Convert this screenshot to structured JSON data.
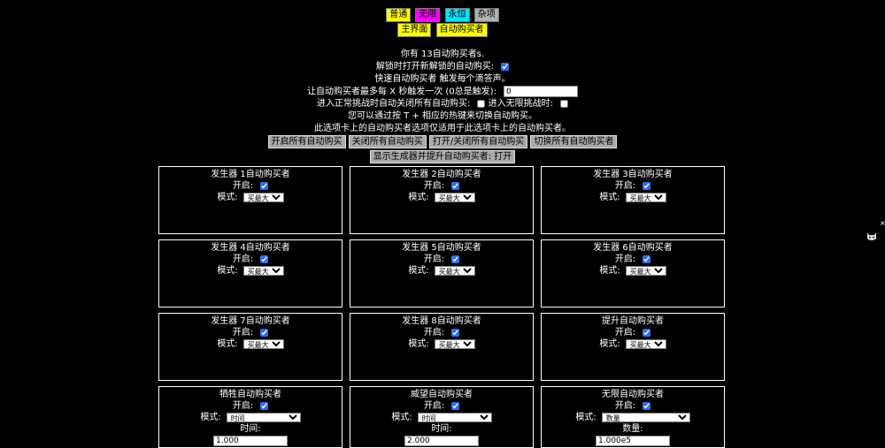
{
  "tabs_top": [
    {
      "label": "普通",
      "color": "#ffff00"
    },
    {
      "label": "无限",
      "color": "#ff00ff"
    },
    {
      "label": "永恒",
      "color": "#00e5ff"
    },
    {
      "label": "杂项",
      "color": "#b0b0b0"
    }
  ],
  "tabs_sub": [
    {
      "label": "主界面",
      "color": "#ffff00"
    },
    {
      "label": "自动购买者",
      "color": "#ffff00"
    }
  ],
  "info": {
    "have": "你有 13自动购买者s.",
    "unlock_label": "解锁时打开新解锁的自动购买:",
    "fast_label": "快速自动购买者 触发每个滴答声。",
    "interval_label": "让自动购买者最多每 X 秒触发一次 (0总是触发):",
    "interval_value": "0",
    "challenge_label": "进入正常挑战时自动关闭所有自动购买:",
    "inf_challenge_label": "进入无限挑战时:",
    "hotkey_text": "您可以通过按 T + 相应的热键来切换自动购买。",
    "scope_text": "此选项卡上的自动购买者选项仅适用于此选项卡上的自动购买者。"
  },
  "buttons": {
    "enable_all": "开启所有自动购买",
    "disable_all": "关闭所有自动购买",
    "toggle_all": "打开/关闭所有自动购买",
    "switch_all": "切换所有自动购买者",
    "show_gen": "显示生成器并提升自动购买者: 打开"
  },
  "labels": {
    "on": "开启:",
    "mode": "模式:",
    "time": "时间:",
    "amount": "数量:"
  },
  "autobuyers": [
    {
      "title": "发生器 1自动购买者",
      "mode": "买最大"
    },
    {
      "title": "发生器 2自动购买者",
      "mode": "买最大"
    },
    {
      "title": "发生器 3自动购买者",
      "mode": "买最大"
    },
    {
      "title": "发生器 4自动购买者",
      "mode": "买最大"
    },
    {
      "title": "发生器 5自动购买者",
      "mode": "买最大"
    },
    {
      "title": "发生器 6自动购买者",
      "mode": "买最大"
    },
    {
      "title": "发生器 7自动购买者",
      "mode": "买最大"
    },
    {
      "title": "发生器 8自动购买者",
      "mode": "买最大"
    },
    {
      "title": "提升自动购买者",
      "mode": "买最大"
    }
  ],
  "bottom_boxes": [
    {
      "title": "牺牲自动购买者",
      "mode": "时间",
      "field_label": "时间:",
      "field_value": "1.000"
    },
    {
      "title": "威望自动购买者",
      "mode": "时间",
      "field_label": "时间:",
      "field_value": "2.000"
    },
    {
      "title": "无限自动购买者",
      "mode": "数量",
      "field_label": "数量:",
      "field_value": "1.000e5"
    }
  ],
  "side_icon": "cat-icon"
}
